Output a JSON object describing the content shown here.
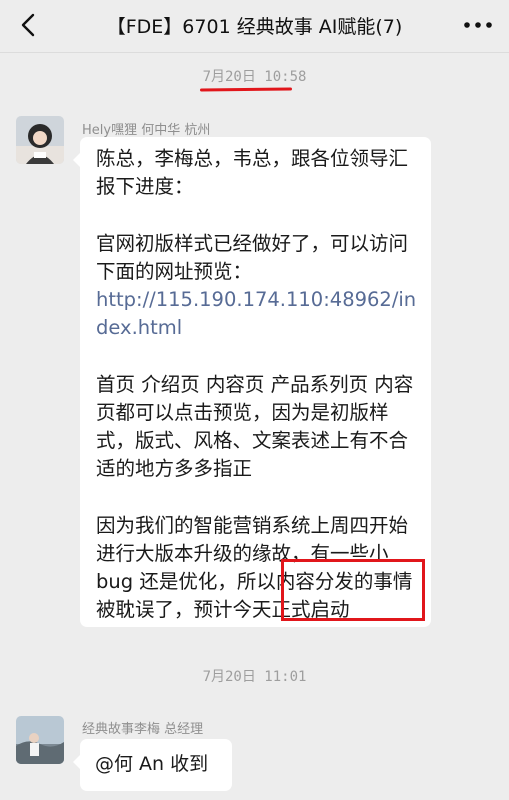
{
  "header": {
    "title": "【FDE】6701 经典故事 AI赋能(7)"
  },
  "timestamps": {
    "first": "7月20日 10:58",
    "second": "7月20日 11:01"
  },
  "messages": [
    {
      "sender": "Hely嘿狸  何中华  杭州",
      "paragraphs": [
        "陈总，李梅总，韦总，跟各位领导汇报下进度：",
        "官网初版样式已经做好了，可以访问 下面的网址预览：",
        "首页 介绍页 内容页 产品系列页 内容页都可以点击预览，因为是初版样式，版式、风格、文案表述上有不合适的地方多多指正",
        "因为我们的智能营销系统上周四开始进行大版本升级的缘故，有一些小 bug 还是优化，所以内容分发的事情被耽误了，预计今天正式启动"
      ],
      "link": "http://115.190.174.110:48962/index.html"
    },
    {
      "sender": "经典故事李梅  总经理",
      "text": "@何 An  收到"
    }
  ],
  "colors": {
    "background": "#ededed",
    "bubble": "#ffffff",
    "link": "#576b95",
    "annotation_red": "#e1161b"
  },
  "icons": {
    "back": "chevron-left-icon",
    "more": "more-dots-icon"
  }
}
